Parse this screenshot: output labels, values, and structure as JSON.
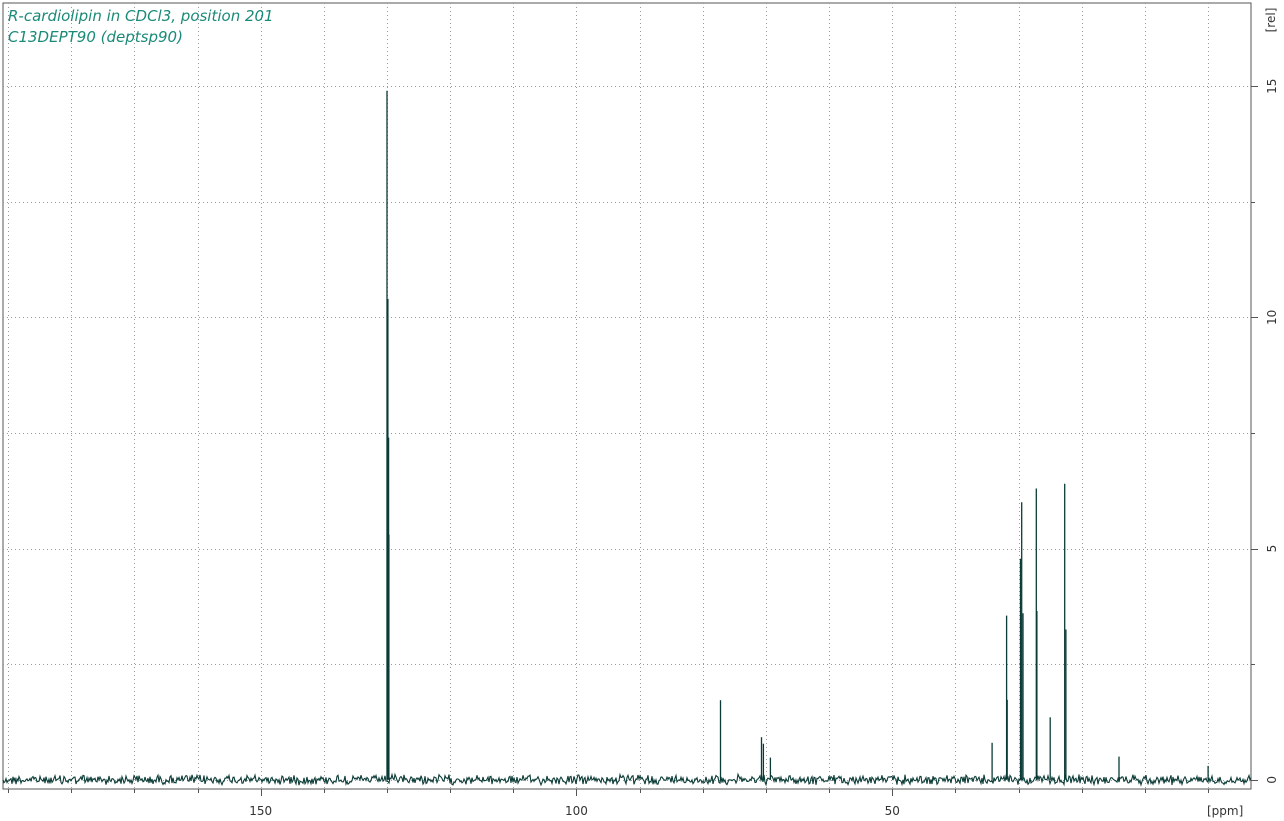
{
  "chart_data": {
    "type": "line",
    "title_lines": [
      "R-cardiolipin in CDCl3, position 201",
      "C13DEPT90 (deptsp90)"
    ],
    "xlabel": "[ppm]",
    "ylabel": "[rel]",
    "x_reversed": true,
    "xlim": [
      190.8,
      -6.8
    ],
    "ylim": [
      -0.2,
      16.8
    ],
    "x_ticks": [
      150,
      100,
      50
    ],
    "x_minor_step": 10,
    "y_ticks": [
      0,
      5,
      10,
      15
    ],
    "y_minor_step": 2.5,
    "grid": true,
    "noise_level": 0.08,
    "peaks": [
      {
        "x": 130.0,
        "y": 14.9
      },
      {
        "x": 129.85,
        "y": 10.4
      },
      {
        "x": 129.75,
        "y": 7.4
      },
      {
        "x": 129.7,
        "y": 5.3
      },
      {
        "x": 77.2,
        "y": 1.72
      },
      {
        "x": 70.7,
        "y": 0.92
      },
      {
        "x": 70.4,
        "y": 0.78
      },
      {
        "x": 69.3,
        "y": 0.48
      },
      {
        "x": 34.2,
        "y": 0.8
      },
      {
        "x": 31.9,
        "y": 3.55
      },
      {
        "x": 31.8,
        "y": 1.73
      },
      {
        "x": 29.7,
        "y": 4.78
      },
      {
        "x": 29.5,
        "y": 6.0
      },
      {
        "x": 29.3,
        "y": 3.6
      },
      {
        "x": 27.2,
        "y": 6.3
      },
      {
        "x": 27.1,
        "y": 3.65
      },
      {
        "x": 25.0,
        "y": 1.35
      },
      {
        "x": 22.7,
        "y": 6.4
      },
      {
        "x": 22.5,
        "y": 3.25
      },
      {
        "x": 14.1,
        "y": 0.5
      },
      {
        "x": 0.0,
        "y": 0.3
      }
    ],
    "colors": {
      "spectrum": "#0b3b36",
      "title": "#1a8a78",
      "grid": "#9a9a9a",
      "frame": "#555555"
    }
  }
}
